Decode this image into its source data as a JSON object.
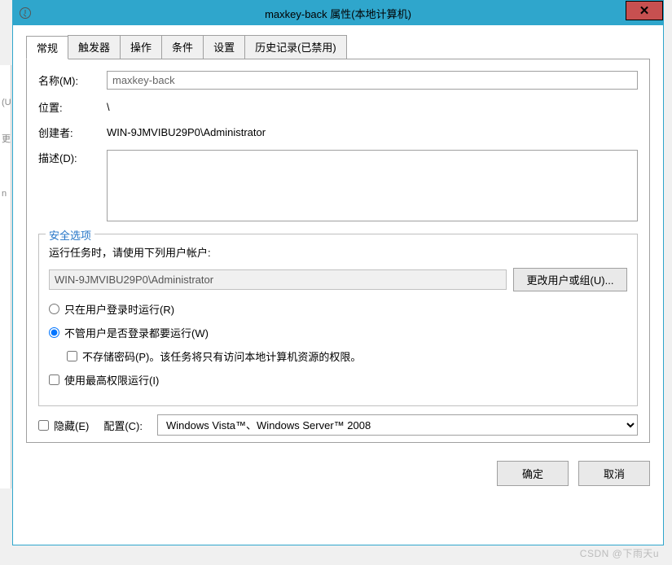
{
  "window": {
    "title": "maxkey-back 属性(本地计算机)"
  },
  "tabs": [
    "常规",
    "触发器",
    "操作",
    "条件",
    "设置",
    "历史记录(已禁用)"
  ],
  "form": {
    "name_label": "名称(M):",
    "name_value": "maxkey-back",
    "location_label": "位置:",
    "location_value": "\\",
    "creator_label": "创建者:",
    "creator_value": "WIN-9JMVIBU29P0\\Administrator",
    "description_label": "描述(D):",
    "description_value": ""
  },
  "security": {
    "legend": "安全选项",
    "run_as_prompt": "运行任务时，请使用下列用户帐户:",
    "run_as_user": "WIN-9JMVIBU29P0\\Administrator",
    "change_user_btn": "更改用户或组(U)...",
    "radio_logged_on": "只在用户登录时运行(R)",
    "radio_any": "不管用户是否登录都要运行(W)",
    "check_no_store": "不存储密码(P)。该任务将只有访问本地计算机资源的权限。",
    "check_highest": "使用最高权限运行(I)"
  },
  "bottom": {
    "hidden_label": "隐藏(E)",
    "config_label": "配置(C):",
    "config_value": "Windows Vista™、Windows Server™ 2008"
  },
  "buttons": {
    "ok": "确定",
    "cancel": "取消"
  },
  "watermark": "CSDN @下雨天u",
  "bg_edge": {
    "a": "(U",
    "b": "更",
    "c": "n"
  }
}
